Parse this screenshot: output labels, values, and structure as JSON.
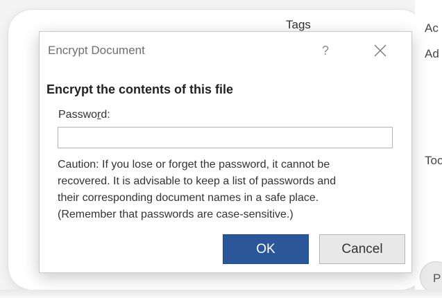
{
  "background": {
    "tags_label": "Tags",
    "cropped_right_1": "Ac",
    "cropped_right_2": "Ad",
    "cropped_right_3": "Too",
    "cropped_bottom_circle": "P"
  },
  "dialog": {
    "title": "Encrypt Document",
    "help_glyph": "?",
    "close_icon": "close-icon",
    "heading": "Encrypt the contents of this file",
    "password_label_before": "Passwo",
    "password_label_accel": "r",
    "password_label_after": "d:",
    "password_value": "",
    "caution_lines": [
      "Caution: If you lose or forget the password, it cannot be",
      "recovered. It is advisable to keep a list of passwords and",
      "their corresponding document names in a safe place.",
      "(Remember that passwords are case-sensitive.)"
    ],
    "ok_label": "OK",
    "cancel_label": "Cancel"
  },
  "colors": {
    "ok_button": "#2b579a",
    "cancel_button": "#e8e8e8",
    "dialog_background": "#ffffff"
  }
}
